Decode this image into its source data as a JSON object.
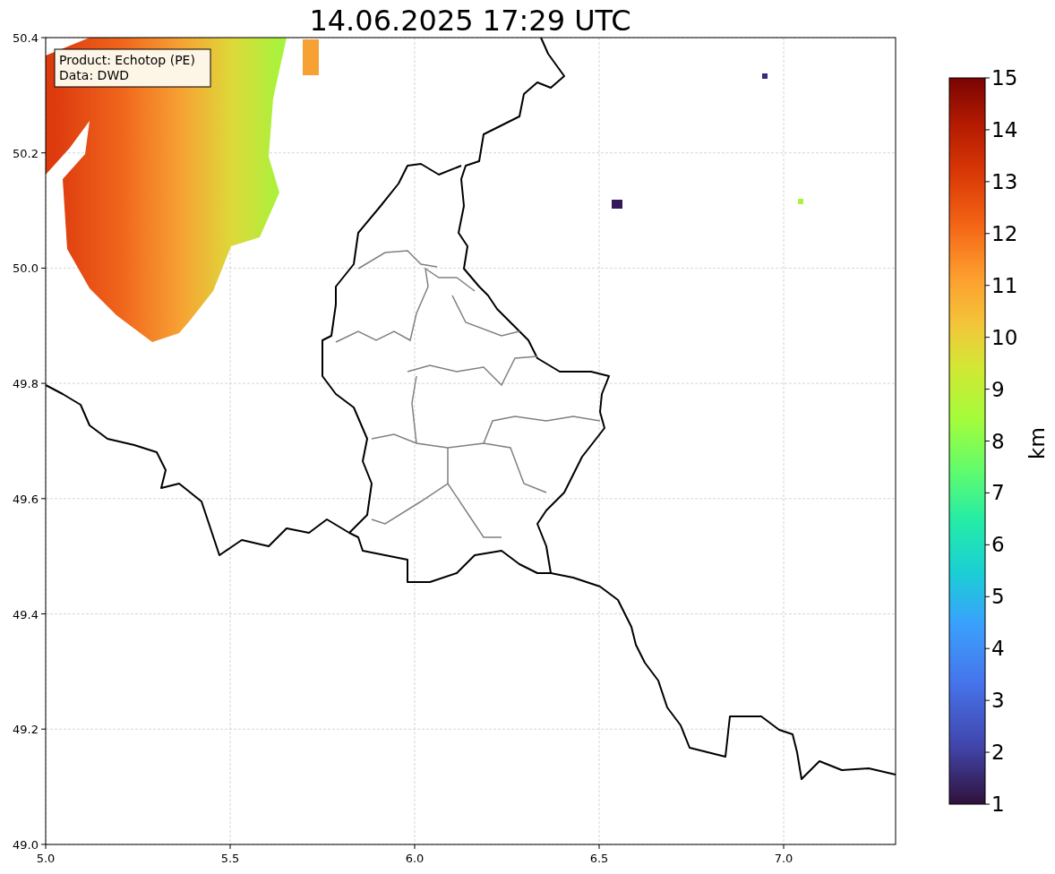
{
  "title": "14.06.2025 17:29 UTC",
  "legend": {
    "lines": [
      "Product: Echotop (PE)",
      "Data: DWD"
    ]
  },
  "x_axis": {
    "tick_labels": [
      "5.0",
      "5.5",
      "6.0",
      "6.5",
      "7.0"
    ]
  },
  "y_axis": {
    "tick_labels": [
      "50.4",
      "50.2",
      "50.0",
      "49.8",
      "49.6",
      "49.4",
      "49.2",
      "49.0"
    ]
  },
  "colorbar": {
    "label": "km",
    "tick_labels": [
      "15",
      "14",
      "13",
      "12",
      "11",
      "10",
      "9",
      "8",
      "7",
      "6",
      "5",
      "4",
      "3",
      "2",
      "1"
    ]
  }
}
